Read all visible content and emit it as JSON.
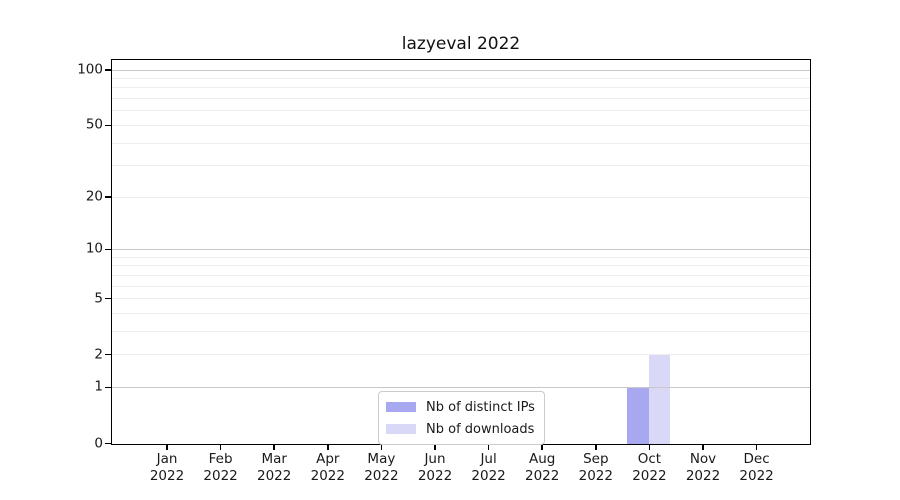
{
  "chart_data": {
    "type": "bar",
    "title": "lazyeval 2022",
    "categories": [
      "Jan",
      "Feb",
      "Mar",
      "Apr",
      "May",
      "Jun",
      "Jul",
      "Aug",
      "Sep",
      "Oct",
      "Nov",
      "Dec"
    ],
    "category_year": "2022",
    "series": [
      {
        "name": "Nb of distinct IPs",
        "color": "#a8a8f0",
        "values": [
          0,
          0,
          0,
          0,
          0,
          0,
          0,
          0,
          0,
          1,
          0,
          0
        ]
      },
      {
        "name": "Nb of downloads",
        "color": "#d9d9f7",
        "values": [
          0,
          0,
          0,
          0,
          0,
          0,
          0,
          0,
          0,
          2,
          0,
          0
        ]
      }
    ],
    "xlabel": "",
    "ylabel": "",
    "yscale": "log1p",
    "yticks": [
      0,
      1,
      2,
      5,
      10,
      20,
      50,
      100
    ],
    "ylim": [
      0,
      113
    ],
    "grid": "horizontal",
    "grid_decade_color": "#c8c8c8",
    "grid_minor_color": "#ededed",
    "legend_position": "lower-center-inside"
  }
}
